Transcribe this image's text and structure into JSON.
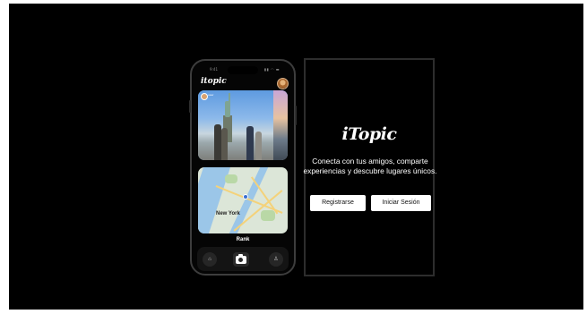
{
  "phone": {
    "status_time": "9:41",
    "status_icons": "▮▮ ◠ ▬",
    "app_logo": "itopic",
    "feed_card_user": "user",
    "map_label": "New York",
    "rank_label": "Rank",
    "tabs": {
      "home_icon": "⌂",
      "profile_icon": "♙"
    }
  },
  "landing": {
    "title": "iTopic",
    "description": "Conecta con tus amigos, comparte experiencias y descubre lugares únicos.",
    "register_label": "Registrarse",
    "login_label": "Iniciar Sesión"
  },
  "colors": {
    "background": "#000000",
    "button_bg": "#ffffff",
    "button_text": "#111111"
  }
}
